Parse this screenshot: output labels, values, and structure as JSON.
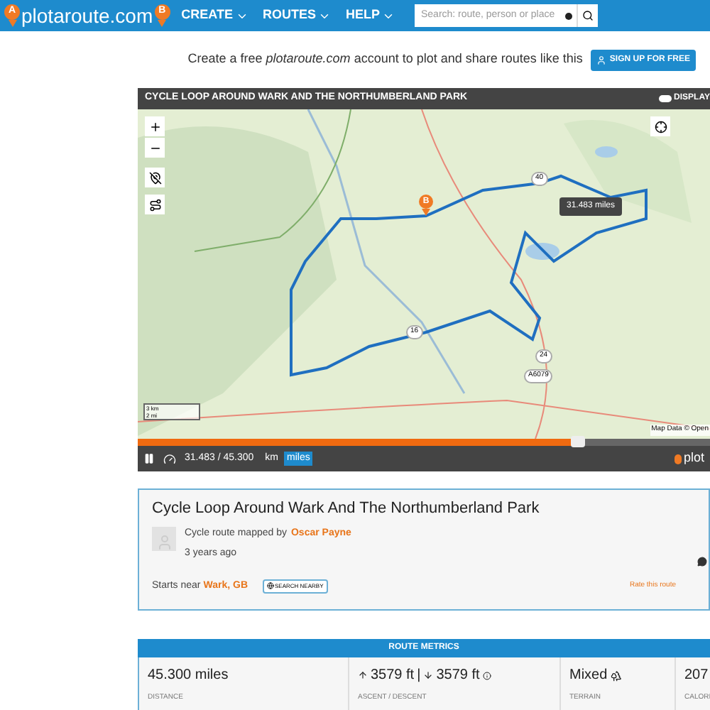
{
  "header": {
    "logo": "plotaroute.com",
    "logo_pins": [
      "A",
      "B"
    ],
    "nav": [
      {
        "label": "CREATE"
      },
      {
        "label": "ROUTES"
      },
      {
        "label": "HELP"
      }
    ],
    "search": {
      "placeholder": "Search: route, person or place"
    }
  },
  "signup": {
    "text": "Create a free *plotaroute.com* account to plot and share routes like this",
    "button": "SIGN UP FOR FREE"
  },
  "map": {
    "title": "CYCLE LOOP AROUND WARK AND THE NORTHUMBERLAND PARK",
    "display_toggle": "DISPLAY",
    "marker": "B",
    "tooltip": "31.483 miles",
    "road_labels": [
      "40",
      "16",
      "24",
      "A6079"
    ],
    "scale": [
      "3 km",
      "2 mi"
    ],
    "attribution": "Map Data © Open",
    "progress": {
      "level": 0.77
    },
    "reading": "31.483 / 45.300",
    "units": [
      {
        "label": "km",
        "selected": false
      },
      {
        "label": "miles",
        "selected": true
      }
    ],
    "brand": "plot"
  },
  "route": {
    "title": "Cycle Loop Around Wark And The Northumberland Park",
    "mapped_by": "Cycle route mapped by",
    "author": "Oscar Payne",
    "age": "3 years ago",
    "starts_near": "Starts near",
    "place": "Wark, GB",
    "search_nearby": "SEARCH NEARBY",
    "rate": "Rate this route"
  },
  "metrics": {
    "heading": "ROUTE METRICS",
    "items": [
      {
        "kind": "plain",
        "value": "45.300 miles",
        "label": "DISTANCE"
      },
      {
        "kind": "ascent",
        "up": "3579 ft",
        "separator": "|",
        "down": "3579 ft",
        "label": "ASCENT / DESCENT"
      },
      {
        "kind": "terrain",
        "value": "Mixed",
        "label": "TERRAIN"
      },
      {
        "kind": "plain",
        "value": "207",
        "label": "CALORI"
      }
    ]
  }
}
